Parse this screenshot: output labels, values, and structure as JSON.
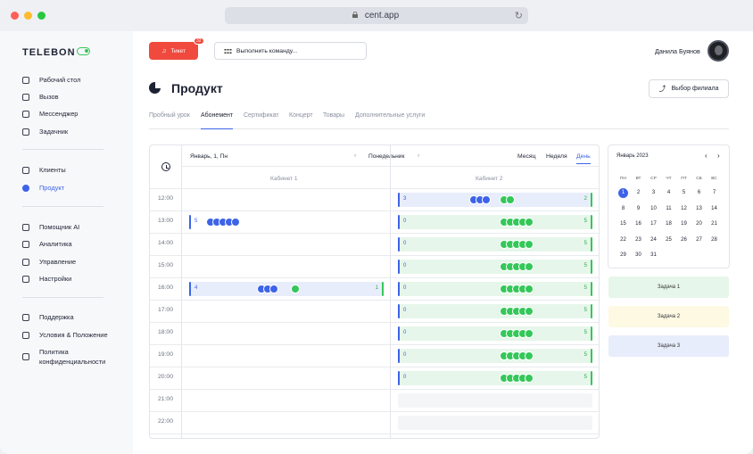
{
  "browser": {
    "url": "cent.app"
  },
  "app": {
    "logo": "TELEBON"
  },
  "sidebar": {
    "items": [
      {
        "label": "Рабочий стол",
        "icon": "home-icon"
      },
      {
        "label": "Вызов",
        "icon": "phone-icon"
      },
      {
        "label": "Мессенджер",
        "icon": "chat-icon"
      },
      {
        "label": "Задачник",
        "icon": "briefcase-icon"
      },
      {
        "label": "Клиенты",
        "icon": "users-icon"
      },
      {
        "label": "Продукт",
        "icon": "pie-chart-icon",
        "active": true
      },
      {
        "label": "Помощник AI",
        "icon": "user-icon"
      },
      {
        "label": "Аналитика",
        "icon": "calendar-icon"
      },
      {
        "label": "Управление",
        "icon": "external-icon"
      },
      {
        "label": "Настройки",
        "icon": "gear-icon"
      },
      {
        "label": "Поддержка",
        "icon": "headset-icon"
      },
      {
        "label": "Условия & Положение",
        "icon": "info-icon"
      },
      {
        "label": "Политика",
        "label2": "конфиденциальности",
        "icon": "document-icon"
      }
    ]
  },
  "header": {
    "ticket_label": "Тикет",
    "ticket_badge": "32",
    "command_placeholder": "Выполнить команду...",
    "user_name": "Данила Буянов"
  },
  "page": {
    "title": "Продукт",
    "branch_button": "Выбор филиала"
  },
  "tabs": [
    "Пробный урок",
    "Абонемент",
    "Сертификат",
    "Концерт",
    "Товары",
    "Дополнительные услуги"
  ],
  "active_tab": "Абонемент",
  "calendar": {
    "date_label": "Январь, 1, Пн",
    "day_label": "Понедельник",
    "prev": "‹",
    "next": "›",
    "views": [
      "Месяц",
      "Неделя",
      "День"
    ],
    "active_view": "День",
    "columns": [
      "Кабинет 1",
      "Кабинет 2"
    ],
    "times": [
      "12:00",
      "13:00",
      "14:00",
      "15:00",
      "16:00",
      "17:00",
      "18:00",
      "19:00",
      "20:00",
      "21:00",
      "22:00"
    ],
    "room1": [
      {
        "time": "13:00",
        "count": "5",
        "avatars": 5,
        "color": "blue"
      },
      {
        "time": "16:00",
        "count": "4",
        "avatars_blue": 3,
        "avatars_green": 1,
        "right": "1",
        "color": "blue"
      }
    ],
    "room2": [
      {
        "time": "12:00",
        "left": "3",
        "right": "2",
        "color": "blue"
      },
      {
        "time": "13:00",
        "left": "0",
        "right": "5"
      },
      {
        "time": "14:00",
        "left": "0",
        "right": "5"
      },
      {
        "time": "15:00",
        "left": "0",
        "right": "5"
      },
      {
        "time": "16:00",
        "left": "0",
        "right": "5"
      },
      {
        "time": "17:00",
        "left": "0",
        "right": "5"
      },
      {
        "time": "18:00",
        "left": "0",
        "right": "5"
      },
      {
        "time": "19:00",
        "left": "0",
        "right": "5"
      },
      {
        "time": "20:00",
        "left": "0",
        "right": "5"
      },
      {
        "time": "21:00",
        "empty": true
      },
      {
        "time": "22:00",
        "empty": true
      }
    ]
  },
  "mini_calendar": {
    "title": "Январь 2023",
    "prev": "‹",
    "next": "›",
    "weekdays": [
      "ПН",
      "ВТ",
      "СР",
      "ЧТ",
      "ПТ",
      "СБ",
      "ВС"
    ],
    "days": [
      "1",
      "2",
      "3",
      "4",
      "5",
      "6",
      "7",
      "8",
      "9",
      "10",
      "11",
      "12",
      "13",
      "14",
      "15",
      "16",
      "17",
      "18",
      "19",
      "20",
      "21",
      "22",
      "23",
      "24",
      "25",
      "26",
      "27",
      "28",
      "29",
      "30",
      "31"
    ],
    "selected": "1"
  },
  "tasks": [
    {
      "label": "Задача 1",
      "color": "#e6f6ea"
    },
    {
      "label": "Задача 2",
      "color": "#fdf9e3"
    },
    {
      "label": "Задача 3",
      "color": "#e8edfb"
    }
  ],
  "colors": {
    "accent": "#3d63e8",
    "ticket": "#f04a3e",
    "success": "#34c759"
  }
}
